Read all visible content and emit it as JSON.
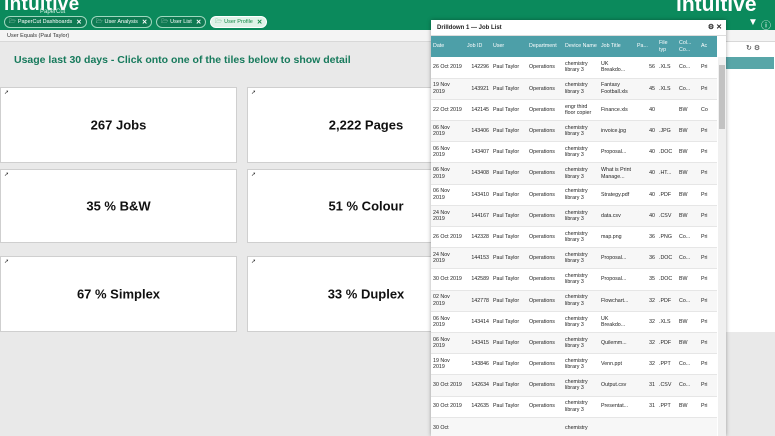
{
  "app": {
    "logo": "intuitive",
    "logo_sub": "PaperCut",
    "logo_right": "intuitive"
  },
  "tabs": [
    {
      "label": "PaperCut Dashboards"
    },
    {
      "label": "User Analysis"
    },
    {
      "label": "User List"
    },
    {
      "label": "User Profile"
    }
  ],
  "filter": {
    "label": "User Equals (Paul Taylor)"
  },
  "heading": "Usage last 30 days - Click onto one of the tiles below to show detail",
  "tiles": [
    {
      "label": "267 Jobs"
    },
    {
      "label": "2,222 Pages"
    },
    {
      "label": "35 % B&W"
    },
    {
      "label": "51 % Colour"
    },
    {
      "label": "67 % Simplex"
    },
    {
      "label": "33 % Duplex"
    }
  ],
  "drilldown": {
    "title": "Drilldown 1 — Job List",
    "columns": [
      "Date",
      "Job ID",
      "User",
      "Department",
      "Device Name",
      "Job Title",
      "Pa...",
      "File typ",
      "Col... Co...",
      "Ac"
    ],
    "rows": [
      [
        "26 Oct 2019",
        "142296",
        "Paul Taylor",
        "Operations",
        "chemistry library 3",
        "UK Breakdo...",
        "56",
        ".XLS",
        "Co...",
        "Pri"
      ],
      [
        "19 Nov 2019",
        "143921",
        "Paul Taylor",
        "Operations",
        "chemistry library 3",
        "Fantasy Football.xls",
        "45",
        ".XLS",
        "Co...",
        "Pri"
      ],
      [
        "22 Oct 2019",
        "142145",
        "Paul Taylor",
        "Operations",
        "engr third floor copier",
        "Finance.xls",
        "40",
        "",
        "BW",
        "Co"
      ],
      [
        "06 Nov 2019",
        "143406",
        "Paul Taylor",
        "Operations",
        "chemistry library 3",
        "invoice.jpg",
        "40",
        ".JPG",
        "BW",
        "Pri"
      ],
      [
        "06 Nov 2019",
        "143407",
        "Paul Taylor",
        "Operations",
        "chemistry library 3",
        "Proposal...",
        "40",
        ".DOC",
        "BW",
        "Pri"
      ],
      [
        "06 Nov 2019",
        "143408",
        "Paul Taylor",
        "Operations",
        "chemistry library 3",
        "What is Print Manage...",
        "40",
        ".HT...",
        "BW",
        "Pri"
      ],
      [
        "06 Nov 2019",
        "143410",
        "Paul Taylor",
        "Operations",
        "chemistry library 3",
        "Strategy.pdf",
        "40",
        ".PDF",
        "BW",
        "Pri"
      ],
      [
        "24 Nov 2019",
        "144167",
        "Paul Taylor",
        "Operations",
        "chemistry library 3",
        "data.csv",
        "40",
        ".CSV",
        "BW",
        "Pri"
      ],
      [
        "26 Oct 2019",
        "142328",
        "Paul Taylor",
        "Operations",
        "chemistry library 3",
        "map.png",
        "36",
        ".PNG",
        "Co...",
        "Pri"
      ],
      [
        "24 Nov 2019",
        "144153",
        "Paul Taylor",
        "Operations",
        "chemistry library 3",
        "Proposal...",
        "36",
        ".DOC",
        "Co...",
        "Pri"
      ],
      [
        "30 Oct 2019",
        "142589",
        "Paul Taylor",
        "Operations",
        "chemistry library 3",
        "Proposal...",
        "35",
        ".DOC",
        "BW",
        "Pri"
      ],
      [
        "02 Nov 2019",
        "142778",
        "Paul Taylor",
        "Operations",
        "chemistry library 3",
        "Flowchart...",
        "32",
        ".PDF",
        "Co...",
        "Pri"
      ],
      [
        "06 Nov 2019",
        "143414",
        "Paul Taylor",
        "Operations",
        "chemistry library 3",
        "UK Breakdo...",
        "32",
        ".XLS",
        "BW",
        "Pri"
      ],
      [
        "06 Nov 2019",
        "143415",
        "Paul Taylor",
        "Operations",
        "chemistry library 3",
        "Quilemm...",
        "32",
        ".PDF",
        "BW",
        "Pri"
      ],
      [
        "19 Nov 2019",
        "143846",
        "Paul Taylor",
        "Operations",
        "chemistry library 3",
        "Venn.ppt",
        "32",
        ".PPT",
        "Co...",
        "Pri"
      ],
      [
        "30 Oct 2019",
        "142634",
        "Paul Taylor",
        "Operations",
        "chemistry library 3",
        "Output.csv",
        "31",
        ".CSV",
        "Co...",
        "Pri"
      ],
      [
        "30 Oct 2019",
        "142635",
        "Paul Taylor",
        "Operations",
        "chemistry library 3",
        "Presentat...",
        "31",
        ".PPT",
        "BW",
        "Pri"
      ],
      [
        "30 Oct",
        "",
        "",
        "",
        "chemistry",
        "",
        "",
        "",
        "",
        ""
      ]
    ]
  }
}
